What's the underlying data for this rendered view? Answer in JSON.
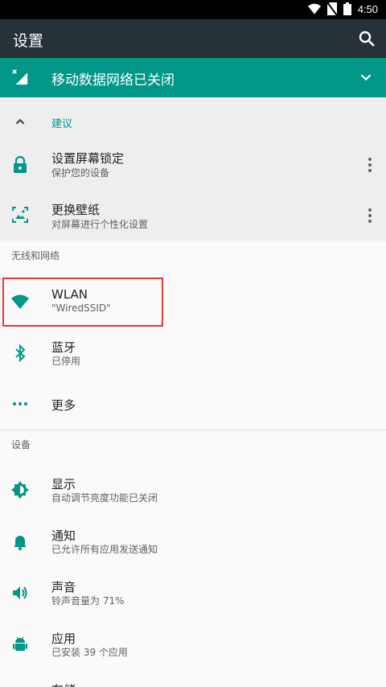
{
  "status_bar": {
    "time": "4:50"
  },
  "toolbar": {
    "title": "设置"
  },
  "banner": {
    "text": "移动数据网络已关闭"
  },
  "suggestions": {
    "header": "建议",
    "items": [
      {
        "title": "设置屏幕锁定",
        "subtitle": "保护您的设备"
      },
      {
        "title": "更换壁纸",
        "subtitle": "对屏幕进行个性化设置"
      }
    ]
  },
  "wireless": {
    "header": "无线和网络",
    "wlan": {
      "title": "WLAN",
      "subtitle": "\"WiredSSID\""
    },
    "bluetooth": {
      "title": "蓝牙",
      "subtitle": "已停用"
    },
    "more": {
      "title": "更多"
    }
  },
  "device": {
    "header": "设备",
    "display": {
      "title": "显示",
      "subtitle": "自动调节亮度功能已关闭"
    },
    "notifications": {
      "title": "通知",
      "subtitle": "已允许所有应用发送通知"
    },
    "sound": {
      "title": "声音",
      "subtitle": "铃声音量为 71%"
    },
    "apps": {
      "title": "应用",
      "subtitle": "已安装 39 个应用"
    },
    "storage": {
      "title": "存储"
    }
  },
  "colors": {
    "accent": "#009688",
    "toolbar": "#263238",
    "highlight": "#e53935"
  }
}
